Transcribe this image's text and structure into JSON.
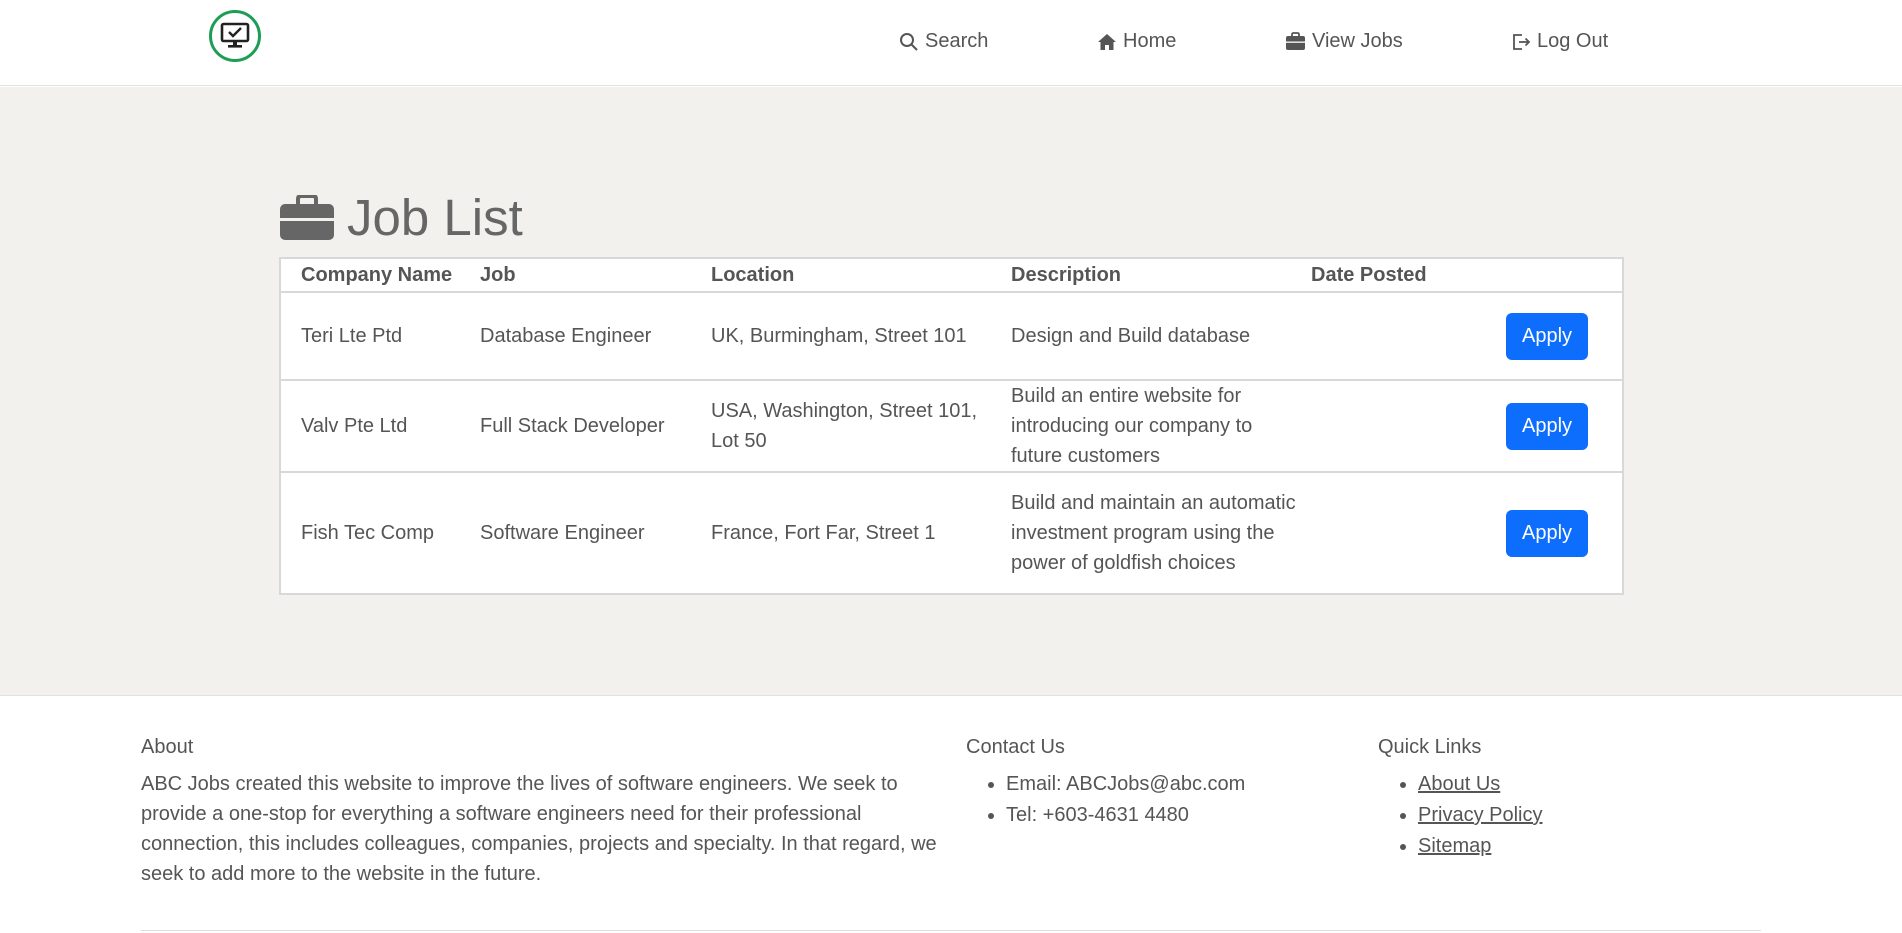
{
  "nav": {
    "search": "Search",
    "home": "Home",
    "view_jobs": "View Jobs",
    "logout": "Log Out"
  },
  "page": {
    "title": "Job List"
  },
  "table": {
    "headers": [
      "Company Name",
      "Job",
      "Location",
      "Description",
      "Date Posted"
    ],
    "rows": [
      {
        "company": "Teri Lte Ptd",
        "job": "Database Engineer",
        "location": "UK, Burmingham, Street 101",
        "description": "Design and Build database",
        "date": "",
        "action": "Apply"
      },
      {
        "company": "Valv Pte Ltd",
        "job": "Full Stack Developer",
        "location": "USA, Washington, Street 101, Lot 50",
        "description": "Build an entire website for introducing our company to future customers",
        "date": "",
        "action": "Apply"
      },
      {
        "company": "Fish Tec Comp",
        "job": "Software Engineer",
        "location": "France, Fort Far, Street 1",
        "description": "Build and maintain an automatic investment program using the power of goldfish choices",
        "date": "",
        "action": "Apply"
      }
    ]
  },
  "footer": {
    "about_title": "About",
    "about_text": "ABC Jobs created this website to improve the lives of software engineers. We seek to provide a one-stop for everything a software engineers need for their professional connection, this includes colleagues, companies, projects and specialty. In that regard, we seek to add more to the website in the future.",
    "contact_title": "Contact Us",
    "contact_items": [
      "Email: ABCJobs@abc.com",
      "Tel: +603-4631 4480"
    ],
    "links_title": "Quick Links",
    "links": [
      "About Us",
      "Privacy Policy",
      "Sitemap"
    ]
  },
  "colors": {
    "accent": "#0d6efd",
    "logo_ring": "#1e9e55",
    "main_bg": "#f2f1ee"
  },
  "icons": {
    "logo": "monitor-check-icon",
    "search": "search-icon",
    "home": "home-icon",
    "view_jobs": "briefcase-icon",
    "logout": "logout-icon",
    "title": "briefcase-icon"
  }
}
